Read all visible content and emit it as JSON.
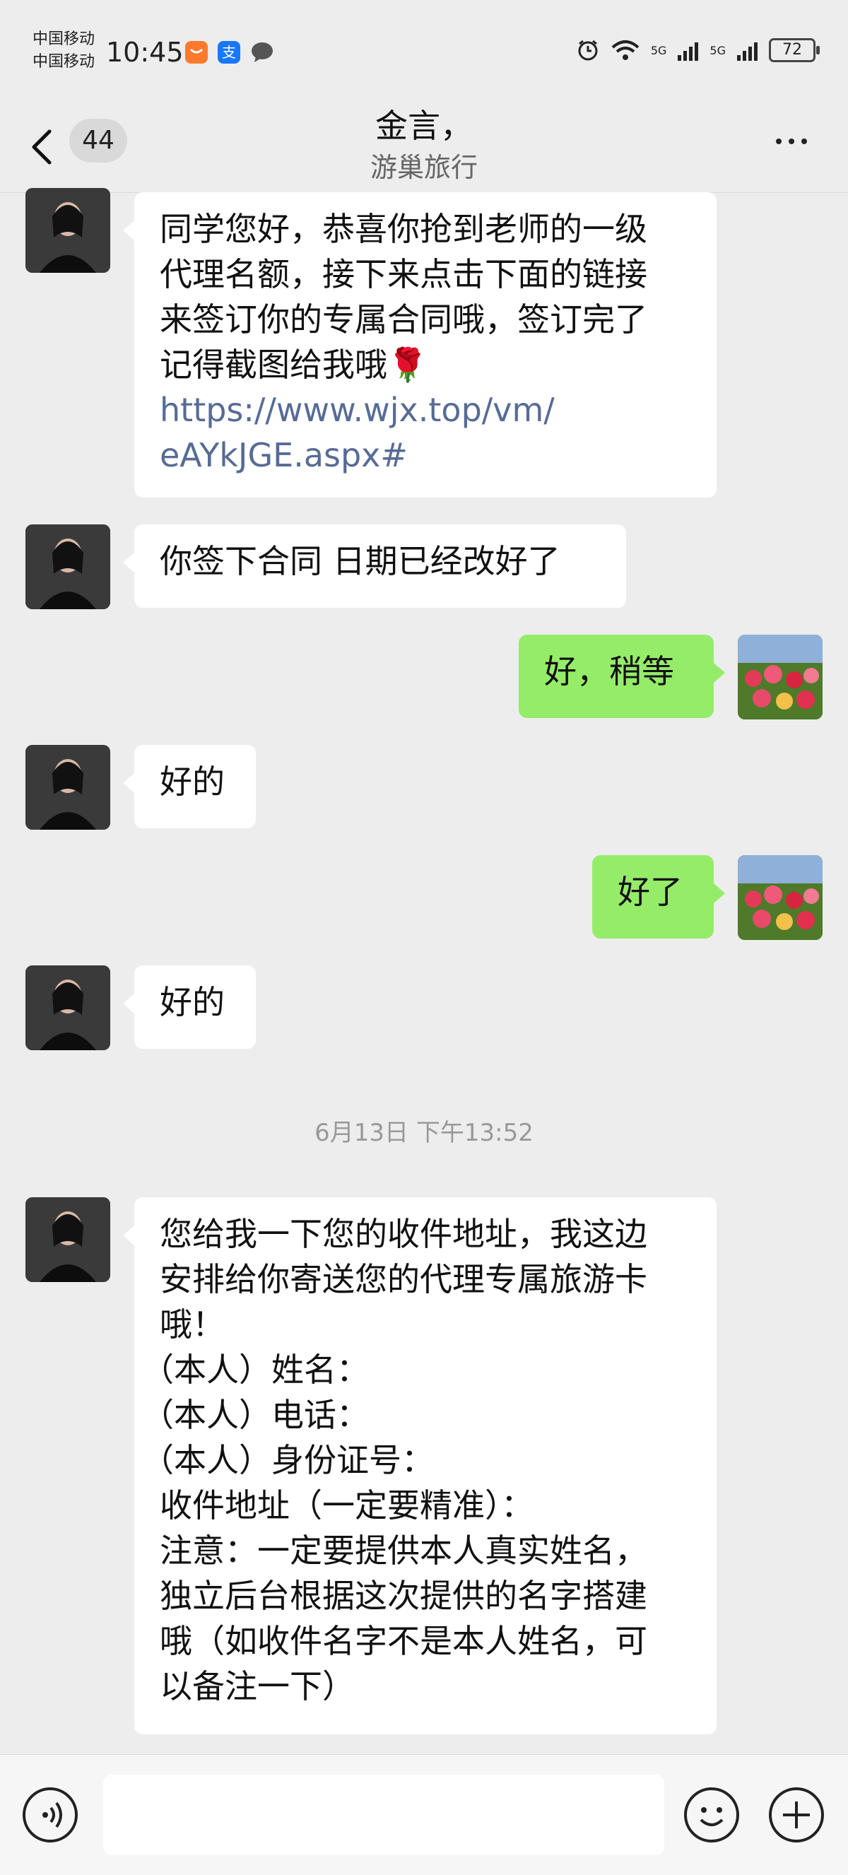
{
  "status_bar": {
    "carrier_1": "中国移动",
    "carrier_2": "中国移动",
    "time": "10:45",
    "app_badge_1": "支",
    "network_1": "5G",
    "network_2": "5G",
    "battery": "72"
  },
  "header": {
    "unread_count": "44",
    "contact_name": "金言，",
    "contact_company": "游巢旅行"
  },
  "messages": [
    {
      "from": "contact",
      "lines": [
        "同学您好，恭喜你抢到老师的一级",
        "代理名额，接下来点击下面的链接",
        "来签订你的专属合同哦，签订完了",
        "记得截图给我哦🌹"
      ],
      "link_lines": [
        "https://www.wjx.top/vm/",
        "eAYkJGE.aspx#"
      ]
    },
    {
      "from": "contact",
      "text": "你签下合同 日期已经改好了"
    },
    {
      "from": "me",
      "text": "好，稍等"
    },
    {
      "from": "contact",
      "text": "好的"
    },
    {
      "from": "me",
      "text": "好了"
    },
    {
      "from": "contact",
      "text": "好的"
    },
    {
      "from": "contact",
      "lines": [
        "您给我一下您的收件地址，我这边",
        "安排给你寄送您的代理专属旅游卡",
        "哦！",
        "（本人）姓名：",
        "（本人）电话：",
        "（本人）身份证号：",
        "收件地址（一定要精准）：",
        "注意：一定要提供本人真实姓名，",
        "独立后台根据这次提供的名字搭建",
        "哦（如收件名字不是本人姓名，可",
        "以备注一下）"
      ]
    }
  ],
  "timestamp": "6月13日 下午13:52",
  "icons": [
    "back-icon",
    "more-icon",
    "voice-icon",
    "emoji-icon",
    "plus-icon"
  ]
}
